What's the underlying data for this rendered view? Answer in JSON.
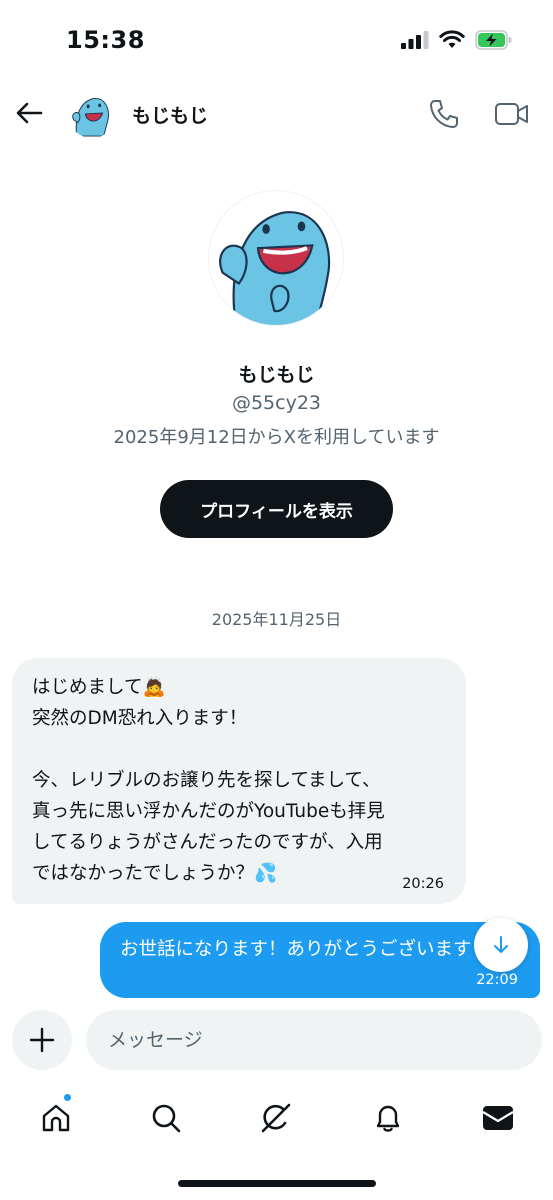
{
  "status_bar": {
    "time": "15:38",
    "icons": [
      "signal-icon",
      "wifi-icon",
      "battery-charging-icon"
    ],
    "battery_color": "#34c759"
  },
  "header": {
    "back_icon": "back-arrow-icon",
    "name": "もじもじ",
    "call_icon": "phone-icon",
    "video_icon": "video-camera-icon"
  },
  "profile": {
    "name": "もじもじ",
    "handle": "@55cy23",
    "joined": "2025年9月12日からXを利用しています",
    "button_label": "プロフィールを表示"
  },
  "conversation": {
    "date_separator": "2025年11月25日",
    "received": {
      "lines": [
        "はじめまして🙇",
        "突然のDM恐れ入ります！",
        "",
        "今、レリブルのお譲り先を探してまして、",
        "真っ先に思い浮かんだのがYouTubeも拝見",
        "してるりょうがさんだったのですが、入用",
        "ではなかったでしょうか？💦"
      ],
      "time": "20:26"
    },
    "sent": {
      "text": "お世話になります！ありがとうございます",
      "time": "22:09"
    },
    "scroll_down_icon": "arrow-down-icon"
  },
  "composer": {
    "add_icon": "plus-icon",
    "placeholder": "メッセージ"
  },
  "bottom_nav": {
    "items": [
      "home-icon",
      "search-icon",
      "grok-icon",
      "notifications-bell-icon",
      "messages-envelope-icon"
    ],
    "home_badge_color": "#1d9bf0"
  },
  "colors": {
    "accent": "#1d9bf0",
    "text": "#0f1419",
    "secondary_text": "#536471",
    "bubble_gray": "#eff3f4"
  }
}
